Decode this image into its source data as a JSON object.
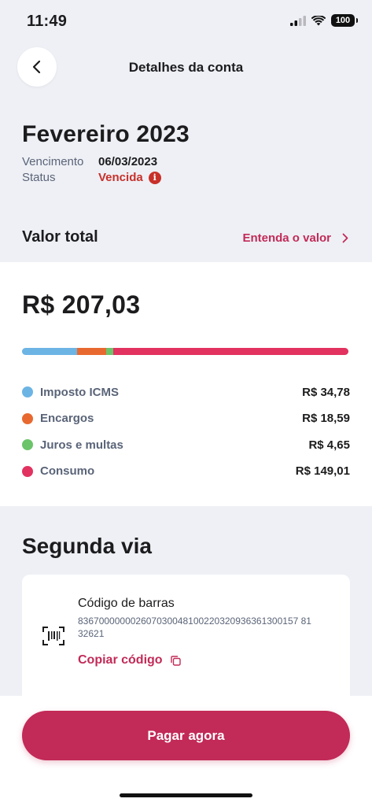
{
  "status_bar": {
    "time": "11:49",
    "battery": "100"
  },
  "header": {
    "title": "Detalhes da conta",
    "back_icon": "chevron-left-icon"
  },
  "bill": {
    "month": "Fevereiro 2023",
    "due_label": "Vencimento",
    "due_date": "06/03/2023",
    "status_label": "Status",
    "status_value": "Vencida",
    "status_info_glyph": "i",
    "status_color": "#c8302a"
  },
  "total": {
    "heading": "Valor total",
    "link": "Entenda o valor",
    "amount": "R$ 207,03",
    "breakdown": [
      {
        "label": "Imposto ICMS",
        "value": "R$ 34,78",
        "amount": 34.78,
        "color": "#6cb4e4"
      },
      {
        "label": "Encargos",
        "value": "R$ 18,59",
        "amount": 18.59,
        "color": "#e8692f"
      },
      {
        "label": "Juros e multas",
        "value": "R$ 4,65",
        "amount": 4.65,
        "color": "#6cc46a"
      },
      {
        "label": "Consumo",
        "value": "R$ 149,01",
        "amount": 149.01,
        "color": "#e2325f"
      }
    ]
  },
  "second_copy": {
    "heading": "Segunda via",
    "barcode_title": "Código de barras",
    "barcode_number": "836700000002607030048100220320936361300157 8132621",
    "copy_label": "Copiar código"
  },
  "actions": {
    "pay_label": "Pagar agora"
  },
  "colors": {
    "brand": "#c22a57",
    "background": "#eef0f5"
  }
}
